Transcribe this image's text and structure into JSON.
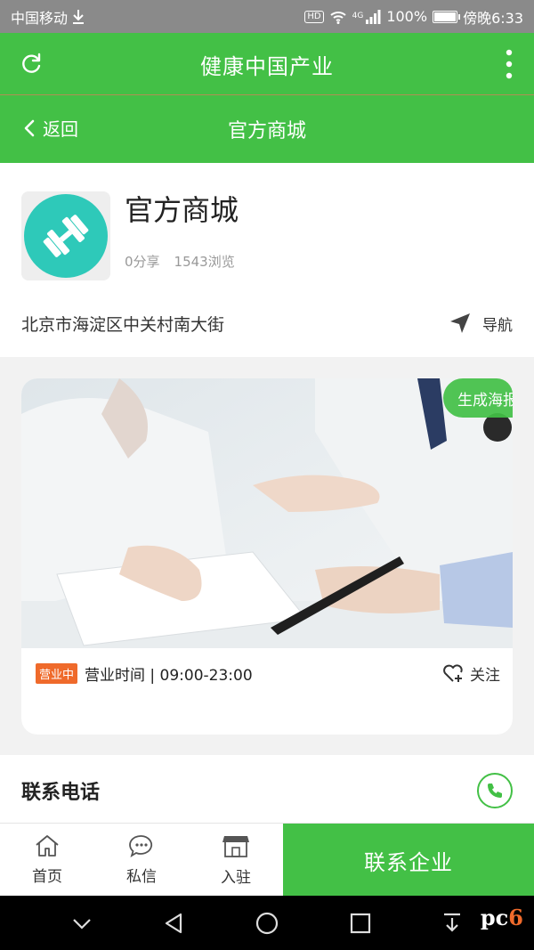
{
  "status_bar": {
    "carrier": "中国移动",
    "hd_badge": "HD",
    "network": "4G",
    "battery": "100%",
    "time": "傍晚6:33"
  },
  "app_bar": {
    "title": "健康中国产业"
  },
  "nav_bar": {
    "back_label": "返回",
    "title": "官方商城"
  },
  "shop": {
    "name": "官方商城",
    "shares": "0分享",
    "views": "1543浏览",
    "address": "北京市海淀区中关村南大街",
    "navigate_label": "导航"
  },
  "photo_card": {
    "poster_label": "生成海报",
    "status_badge": "营业中",
    "hours": "营业时间 | 09:00-23:00",
    "follow_label": "关注"
  },
  "contact": {
    "title": "联系电话"
  },
  "bottom_tabs": {
    "items": [
      {
        "label": "首页",
        "icon": "home-icon"
      },
      {
        "label": "私信",
        "icon": "message-icon"
      },
      {
        "label": "入驻",
        "icon": "store-icon"
      }
    ],
    "contact_company_label": "联系企业"
  },
  "colors": {
    "primary_green": "#43c046",
    "logo_teal": "#2ec9b9",
    "badge_orange": "#ef6a2b"
  },
  "watermark": {
    "prefix": "pc",
    "digit": "6"
  }
}
